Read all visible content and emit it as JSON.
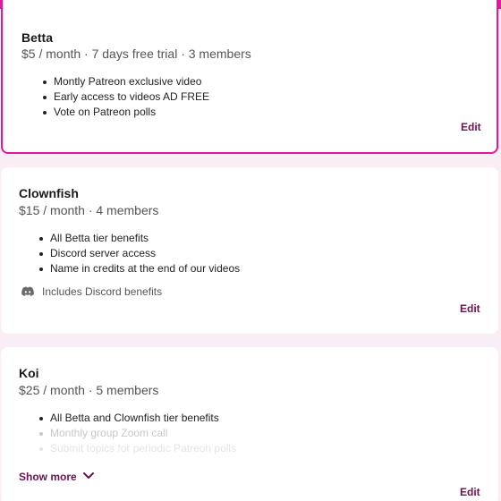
{
  "tiers": [
    {
      "name": "Betta",
      "meta": "$5 / month · 7 days free trial · 3 members",
      "benefits": [
        "Montly Patreon exclusive video",
        "Early access to videos AD FREE",
        "Vote on Patreon polls"
      ],
      "edit_label": "Edit"
    },
    {
      "name": "Clownfish",
      "meta": "$15 / month · 4 members",
      "benefits": [
        "All Betta tier benefits",
        "Discord server access",
        "Name in credits at the end of our videos"
      ],
      "discord_label": "Includes Discord benefits",
      "edit_label": "Edit"
    },
    {
      "name": "Koi",
      "meta": "$25 / month · 5 members",
      "benefits": [
        "All Betta and Clownfish tier benefits",
        "Monthly group Zoom call",
        "Submit topics for periodic Patreon polls"
      ],
      "show_more_label": "Show more",
      "edit_label": "Edit"
    }
  ],
  "colors": {
    "accent": "#e2179d",
    "link": "#6b1250",
    "page_bg": "#f9eef5"
  },
  "icons": {
    "discord": "discord-icon",
    "show_more": "chevron-down-icon"
  }
}
